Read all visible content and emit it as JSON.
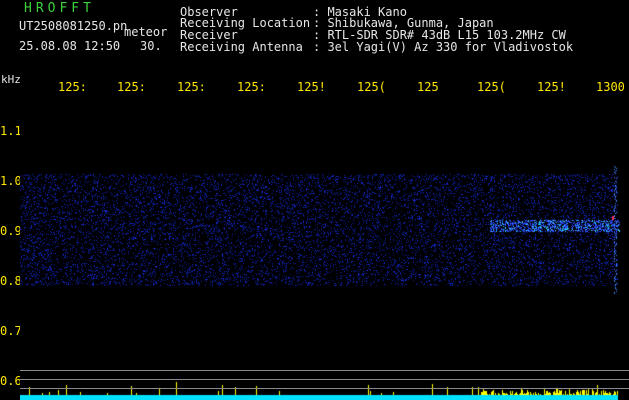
{
  "header": {
    "title": "HROFFT",
    "filename": "UT2508081250.pn",
    "mode": "meteor",
    "datetime": "25.08.08 12:50",
    "duration": "30."
  },
  "info": [
    {
      "key": "Observer",
      "value": ": Masaki Kano"
    },
    {
      "key": "Receiving Location",
      "value": ": Shibukawa, Gunma, Japan"
    },
    {
      "key": "Receiver",
      "value": ": RTL-SDR SDR# 43dB L15 103.2MHz CW"
    },
    {
      "key": "Receiving Antenna",
      "value": ": 3el Yagi(V) Az 330 for Vladivostok"
    }
  ],
  "axis": {
    "y_unit": "kHz",
    "x_ticks": [
      "125:",
      "125:",
      "125:",
      "125:",
      "125!",
      "125(",
      "125",
      "125(",
      "125!",
      "1300"
    ],
    "y_ticks": [
      "1.1",
      "1.0",
      "0.9",
      "0.8",
      "0.7",
      "0.6"
    ]
  },
  "colors": {
    "background": "#000000",
    "title": "#3cd23c",
    "ticks": "#ffe600",
    "text": "#e6e6e6",
    "signal": "#2030ff",
    "meteor": "#30d0ff",
    "intensity": "#ffff00",
    "noise": "#00e0ff"
  }
}
